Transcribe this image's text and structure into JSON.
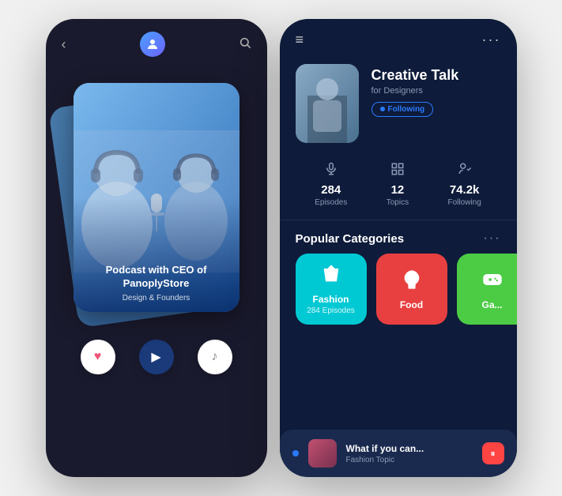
{
  "leftPhone": {
    "header": {
      "backLabel": "‹",
      "avatarIcon": "🎙",
      "searchIcon": "🔍"
    },
    "card": {
      "title": "Podcast with CEO of PanoplyStore",
      "subtitle": "Design & Founders"
    },
    "controls": {
      "heartLabel": "♥",
      "musicLabel": "♪",
      "playLabel": "▶"
    }
  },
  "rightPhone": {
    "header": {
      "hamburgerIcon": "≡",
      "dotsIcon": "···"
    },
    "profile": {
      "name": "Creative Talk",
      "subtitle": "for Designers",
      "followingLabel": "Following"
    },
    "stats": [
      {
        "icon": "🎙",
        "value": "284",
        "label": "Episodes"
      },
      {
        "icon": "📋",
        "value": "12",
        "label": "Topics"
      },
      {
        "icon": "👤",
        "value": "74.2k",
        "label": "Following"
      }
    ],
    "categoriesTitle": "Popular Categories",
    "categoriesDotsIcon": "···",
    "categories": [
      {
        "icon": "👗",
        "name": "Fashion",
        "episodes": "284 Episodes",
        "colorClass": "cat-fashion"
      },
      {
        "icon": "🍔",
        "name": "Food",
        "episodes": "",
        "colorClass": "cat-food"
      },
      {
        "icon": "🎮",
        "name": "Ga...",
        "episodes": "",
        "colorClass": "cat-gaming"
      }
    ],
    "nowPlaying": {
      "title": "What if you can...",
      "subtitle": "Fashion Topic",
      "pauseIcon": "⏸"
    }
  }
}
